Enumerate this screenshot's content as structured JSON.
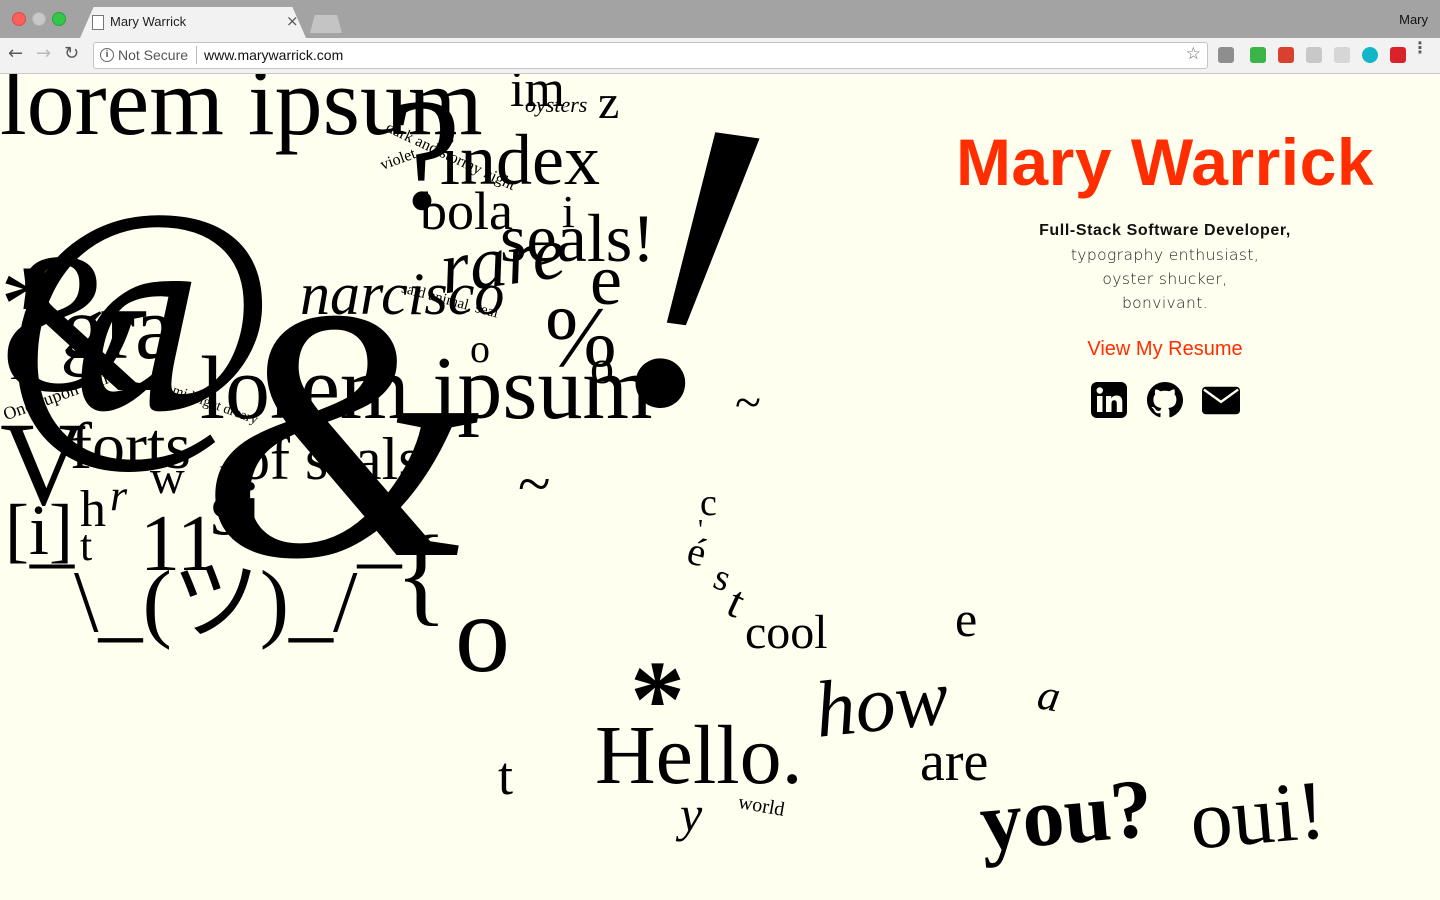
{
  "browser": {
    "tab_title": "Mary Warrick",
    "tab_close": "×",
    "profile_name": "Mary",
    "security_label": "Not Secure",
    "url": "www.marywarrick.com",
    "back": "←",
    "forward": "→",
    "reload": "↻",
    "star": "☆",
    "menu": "⋮",
    "extension_colors": [
      "#8e8e8e",
      "#3bb54a",
      "#d9412f",
      "#c8c8c8",
      "#d6d6d6",
      "#13b6c9",
      "#d9232b"
    ]
  },
  "profile": {
    "name": "Mary Warrick",
    "role": "Full-Stack Software Developer,",
    "bio": [
      "typography enthusiast,",
      "oyster shucker,",
      "bonvivant."
    ],
    "resume_link": "View My Resume",
    "socials": [
      "linkedin-icon",
      "github-icon",
      "email-icon"
    ],
    "accent_color": "#ff2d00",
    "background_color": "#fffff0"
  },
  "typography_art": {
    "words": [
      "lorem ipsum",
      "im",
      "oysters",
      "z",
      "index",
      "dark and stormy night",
      "violet",
      "bola",
      "i",
      "seals!",
      "rare",
      "e",
      "@",
      "&",
      "&",
      "!",
      "?",
      "*",
      "gra",
      "lorem ipsum",
      "%",
      "o",
      "o",
      "i",
      "narcisco",
      "said animal, seal",
      "Once upon a time",
      "midnight dreary",
      "LOL",
      "w",
      "V",
      "forts",
      "of seals",
      "~",
      "~",
      "[i]",
      "h",
      "r",
      "t",
      "11",
      "si",
      "¯\\_(ツ)_/¯",
      "{",
      "o",
      "c",
      "'",
      "é",
      "s",
      "t",
      "cool",
      "e",
      "a",
      "*",
      "how",
      "are",
      "t",
      "Hello.",
      "y",
      "world",
      "you?",
      "oui!"
    ]
  }
}
